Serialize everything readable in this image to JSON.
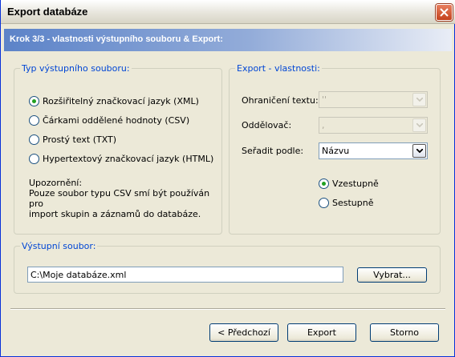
{
  "window": {
    "title": "Export databáze"
  },
  "banner": {
    "text": "Krok 3/3 - vlastnosti výstupního souboru & Export:"
  },
  "output_type": {
    "legend": "Typ výstupního souboru:",
    "options": [
      {
        "label": "Rozšiřitelný značkovací jazyk (XML)",
        "selected": true
      },
      {
        "label": "Čárkami oddělené hodnoty (CSV)",
        "selected": false
      },
      {
        "label": "Prostý text (TXT)",
        "selected": false
      },
      {
        "label": "Hypertextový značkovací jazyk (HTML)",
        "selected": false
      }
    ],
    "note_title": "Upozornění:",
    "note_line1": "Pouze soubor typu CSV smí být používán pro",
    "note_line2": "import skupin a záznamů do databáze."
  },
  "export_props": {
    "legend": "Export - vlastnosti:",
    "text_qualifier": {
      "label": "Ohraničení textu:",
      "value": "''",
      "disabled": true
    },
    "separator": {
      "label": "Oddělovač:",
      "value": ",",
      "disabled": true
    },
    "sort_by": {
      "label": "Seřadit podle:",
      "value": "Názvu",
      "disabled": false
    },
    "order_options": [
      {
        "label": "Vzestupně",
        "selected": true
      },
      {
        "label": "Sestupně",
        "selected": false
      }
    ]
  },
  "output_file": {
    "legend": "Výstupní soubor:",
    "path": "C:\\Moje databáze.xml",
    "browse_label": "Vybrat..."
  },
  "footer": {
    "previous_label": "< Předchozí",
    "export_label": "Export",
    "cancel_label": "Storno"
  },
  "colors": {
    "legend_text": "#0046d5",
    "radio_dot": "#21a121",
    "banner_start": "#5c83c8"
  }
}
